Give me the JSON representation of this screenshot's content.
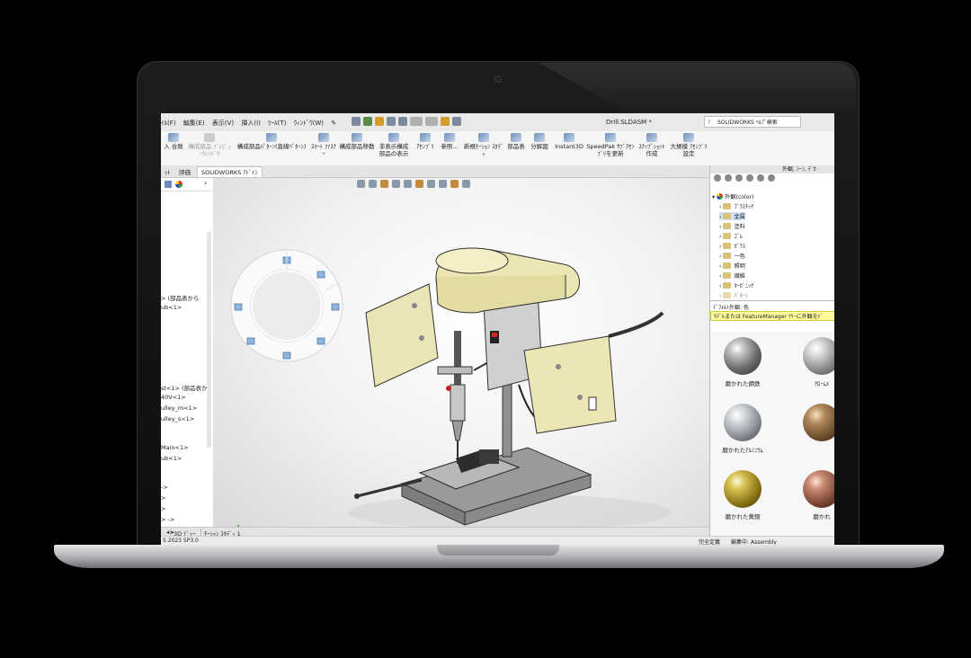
{
  "window": {
    "doc_title": "Drill.SLDASM *",
    "help_search_placeholder": "SOLIDWORKS ﾍﾙﾌﾟ検索"
  },
  "menu": [
    "ｲﾙ(F)",
    "編集(E)",
    "表示(V)",
    "挿入(I)",
    "ﾂｰﾙ(T)",
    "ｳｨﾝﾄﾞｳ(W)"
  ],
  "ribbon": [
    {
      "label": "入 合致",
      "dim": false
    },
    {
      "label": "構成部品 ﾌﾟﾚﾋﾞｭｰｳｨﾝﾄﾞｳ",
      "dim": true
    },
    {
      "label": "構成部品ﾊﾟﾀｰﾝ(直線ﾊﾟﾀｰﾝ)",
      "dim": false
    },
    {
      "label": "ｽﾏｰﾄ ﾌｧｽﾅｰ",
      "dim": false
    },
    {
      "label": "構成部品移動",
      "dim": false
    },
    {
      "label": "非表示構成 部品の表示",
      "dim": false
    },
    {
      "label": "ｱｾﾝﾌﾞﾘ",
      "dim": false
    },
    {
      "label": "参照...",
      "dim": false
    },
    {
      "label": "新規ﾓｰｼｮﾝ ｽﾀﾃﾞｨ",
      "dim": false
    },
    {
      "label": "部品表",
      "dim": false
    },
    {
      "label": "分解図",
      "dim": false
    },
    {
      "label": "Instant3D",
      "dim": false
    },
    {
      "label": "SpeedPak ｻﾌﾞｱｾﾝﾌﾞﾘを更新",
      "dim": false
    },
    {
      "label": "ｽﾅｯﾌﾟｼｮｯﾄ 作成",
      "dim": false
    },
    {
      "label": "大規模 ｱｾﾝﾌﾞﾘ設定",
      "dim": false
    }
  ],
  "command_tabs": [
    "ｯﾄ",
    "評価",
    "SOLIDWORKS ｱﾄﾞｲﾝ"
  ],
  "feature_tree": [
    "> (部品表から",
    "ub<1>",
    "st<1> (部品表か",
    "40V<1>",
    "ulley_m<1>",
    "ulley_s<1>",
    "Main<1>",
    "ub<1>",
    "->",
    ">",
    ">",
    "> ->"
  ],
  "bottom_tabs": [
    "3D ﾋﾞｭｰ",
    "ﾓｰｼｮﾝ ｽﾀﾃﾞｨ 1"
  ],
  "status": {
    "version": "S 2023 SP3.0",
    "definition": "完全定義",
    "editing": "編集中: Assembly"
  },
  "task_pane": {
    "header": "外観, ｼｰﾝ, ﾃﾞｶ",
    "tree": [
      {
        "label": "外観(color)",
        "root": true
      },
      {
        "label": "ﾌﾟﾗｽﾁｯｸ"
      },
      {
        "label": "金属",
        "selected": true
      },
      {
        "label": "塗料"
      },
      {
        "label": "ｺﾞﾑ"
      },
      {
        "label": "ｶﾞﾗｽ"
      },
      {
        "label": "一色"
      },
      {
        "label": "照明"
      },
      {
        "label": "繊維"
      },
      {
        "label": "ｵｰｶﾞﾆｯｸ"
      },
      {
        "label": "ﾊﾟﾀｰﾝ"
      }
    ],
    "default_label": "ﾃﾞﾌｫﾙﾄ外観: 色",
    "tooltip": "ﾓﾃﾞﾙまたは FeatureManager ﾂﾘｰに外観をﾄﾞ",
    "swatches": [
      {
        "label": "磨かれた鋼鉄",
        "color": "#9a9a9a"
      },
      {
        "label": "ｸﾛｰﾑﾒ",
        "color": "#b9b9b9"
      },
      {
        "label": "磨かれたｱﾙﾐﾆｳﾑ",
        "color": "#a7abb0"
      },
      {
        "label": "",
        "color": "#8a6a3e"
      },
      {
        "label": "磨かれた黄銅",
        "color": "#b3962c"
      },
      {
        "label": "磨かれ",
        "color": "#a8674e"
      }
    ]
  }
}
